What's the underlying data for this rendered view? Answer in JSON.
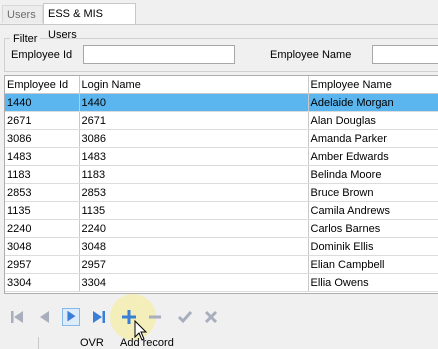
{
  "tabs": [
    {
      "label": "Users",
      "active": false
    },
    {
      "label": "ESS & MIS Users",
      "active": true
    }
  ],
  "filter": {
    "title": "Filter",
    "employee_id_label": "Employee Id",
    "employee_id_value": "",
    "employee_name_label": "Employee Name",
    "employee_name_value": ""
  },
  "grid": {
    "columns": [
      "Employee Id",
      "Login Name",
      "Employee Name"
    ],
    "selected_row": 0,
    "selection_color": "#5bb5ef",
    "rows": [
      [
        "1440",
        "1440",
        "Adelaide Morgan"
      ],
      [
        "2671",
        "2671",
        "Alan Douglas"
      ],
      [
        "3086",
        "3086",
        "Amanda Parker"
      ],
      [
        "1483",
        "1483",
        "Amber Edwards"
      ],
      [
        "1183",
        "1183",
        "Belinda Moore"
      ],
      [
        "2853",
        "2853",
        "Bruce Brown"
      ],
      [
        "1135",
        "1135",
        "Camila Andrews"
      ],
      [
        "2240",
        "2240",
        "Carlos Barnes"
      ],
      [
        "3048",
        "3048",
        "Dominik Ellis"
      ],
      [
        "2957",
        "2957",
        "Elian Campbell"
      ],
      [
        "3304",
        "3304",
        "Ellia Owens"
      ]
    ]
  },
  "navigator": {
    "buttons": [
      {
        "name": "first-record-icon",
        "enabled": false
      },
      {
        "name": "prior-record-icon",
        "enabled": false
      },
      {
        "name": "next-record-icon",
        "enabled": true
      },
      {
        "name": "last-record-icon",
        "enabled": true
      },
      {
        "name": "add-record-icon",
        "enabled": true
      },
      {
        "name": "delete-record-icon",
        "enabled": false
      },
      {
        "name": "post-edit-icon",
        "enabled": false
      },
      {
        "name": "cancel-edit-icon",
        "enabled": false
      }
    ]
  },
  "status": {
    "mode": "OVR",
    "message": "Add record"
  },
  "colors": {
    "accent": "#3a7fd5",
    "disabled": "#a8aebc"
  }
}
